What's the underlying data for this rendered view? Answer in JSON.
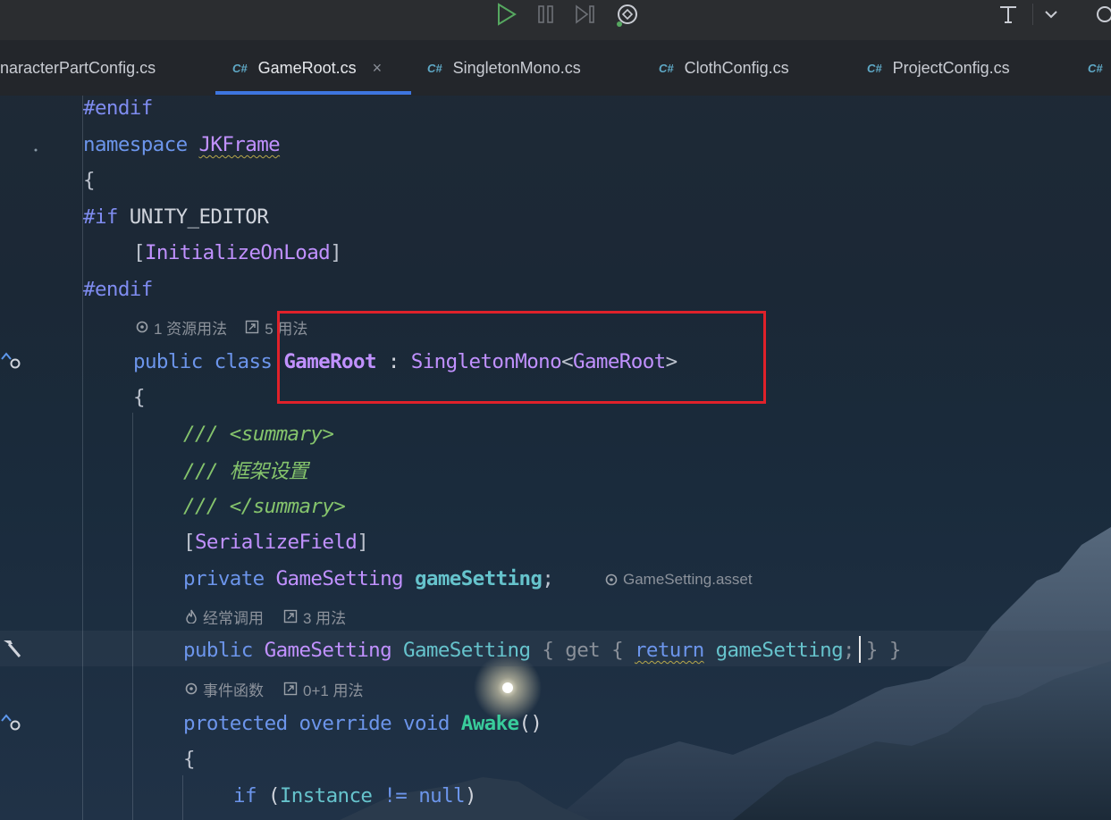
{
  "toolbar": {
    "icons": [
      "run-icon",
      "pause-icon",
      "step-icon",
      "unity-debug-icon",
      "text-tool-icon",
      "chevron-down-icon",
      "settings-icon"
    ]
  },
  "tabs": [
    {
      "label": "naracterPartConfig.cs",
      "badge": ""
    },
    {
      "label": "GameRoot.cs",
      "badge": "C#",
      "active": true,
      "close": "×"
    },
    {
      "label": "SingletonMono.cs",
      "badge": "C#"
    },
    {
      "label": "ClothConfig.cs",
      "badge": "C#"
    },
    {
      "label": "ProjectConfig.cs",
      "badge": "C#"
    },
    {
      "label": "",
      "badge": "C#"
    }
  ],
  "code": {
    "l1_endif": "#endif",
    "l2_namespace_kw": "namespace",
    "l2_namespace_name": "JKFrame",
    "l3_brace": "{",
    "l4_if": "#if",
    "l4_symbol": " UNITY_EDITOR",
    "l5_open": "[",
    "l5_attr": "InitializeOnLoad",
    "l5_close": "]",
    "l6_endif": "#endif",
    "hint1_a": "1 资源用法",
    "hint1_b": "5 用法",
    "l7_public": "public",
    "l7_class": "class",
    "l7_name": "GameRoot",
    "l7_colon": " : ",
    "l7_base": "SingletonMono",
    "l7_lt": "<",
    "l7_generic": "GameRoot",
    "l7_gt": ">",
    "l8_brace": "{",
    "l9_slashes": "/// ",
    "l9_tag": "<summary>",
    "l10_text": "/// 框架设置",
    "l11_slashes": "/// ",
    "l11_tag": "</summary>",
    "l12_open": "[",
    "l12_attr": "SerializeField",
    "l12_close": "]",
    "l13_private": "private",
    "l13_type": "GameSetting",
    "l13_field": "gameSetting",
    "l13_semi": ";",
    "l13_hint": "GameSetting.asset",
    "hint2_a": "经常调用",
    "hint2_b": "3 用法",
    "l14_public": "public",
    "l14_type": "GameSetting",
    "l14_prop": "GameSetting",
    "l14_open": " { ",
    "l14_get": "get",
    "l14_open2": " { ",
    "l14_return": "return",
    "l14_field": "gameSetting",
    "l14_close": "; } }",
    "hint3_a": "事件函数",
    "hint3_b": "0+1 用法",
    "l15_protected": "protected",
    "l15_override": "override",
    "l15_void": "void",
    "l15_method": "Awake",
    "l15_parens": "()",
    "l16_brace": "{",
    "l17_if": "if",
    "l17_open": " (",
    "l17_instance": "Instance",
    "l17_op": " != ",
    "l17_null": "null",
    "l17_close": ")"
  }
}
